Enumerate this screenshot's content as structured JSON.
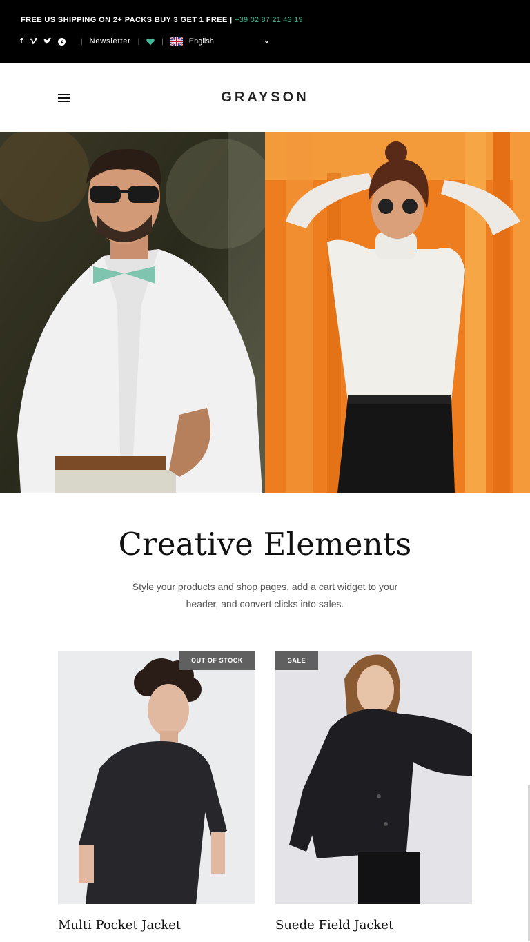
{
  "topbar": {
    "promo_text": "FREE US SHIPPING ON 2+ PACKS BUY 3 GET 1 FREE | ",
    "phone": "+39 02 87 21 43 19",
    "social_icons": [
      "facebook-icon",
      "vimeo-icon",
      "twitter-icon",
      "pinterest-icon"
    ],
    "separator": "|",
    "newsletter_label": "Newsletter",
    "wishlist_icon": "heart-icon",
    "language_flag": "uk-flag-icon",
    "language_label": "English",
    "language_caret": "chevron-down-icon",
    "accent_color": "#3fb99a"
  },
  "header": {
    "menu_icon": "hamburger-icon",
    "logo_text": "GRAYSON"
  },
  "hero": {
    "left_image": "man in white shirt and bow tie",
    "right_image": "woman in white turtleneck on orange background"
  },
  "section": {
    "title": "Creative Elements",
    "subtitle": "Style your products and shop pages, add a cart widget to your header, and convert clicks into sales."
  },
  "products": [
    {
      "name": "Multi Pocket Jacket",
      "badge": "OUT OF STOCK"
    },
    {
      "name": "Suede Field Jacket",
      "badge": "SALE"
    }
  ]
}
